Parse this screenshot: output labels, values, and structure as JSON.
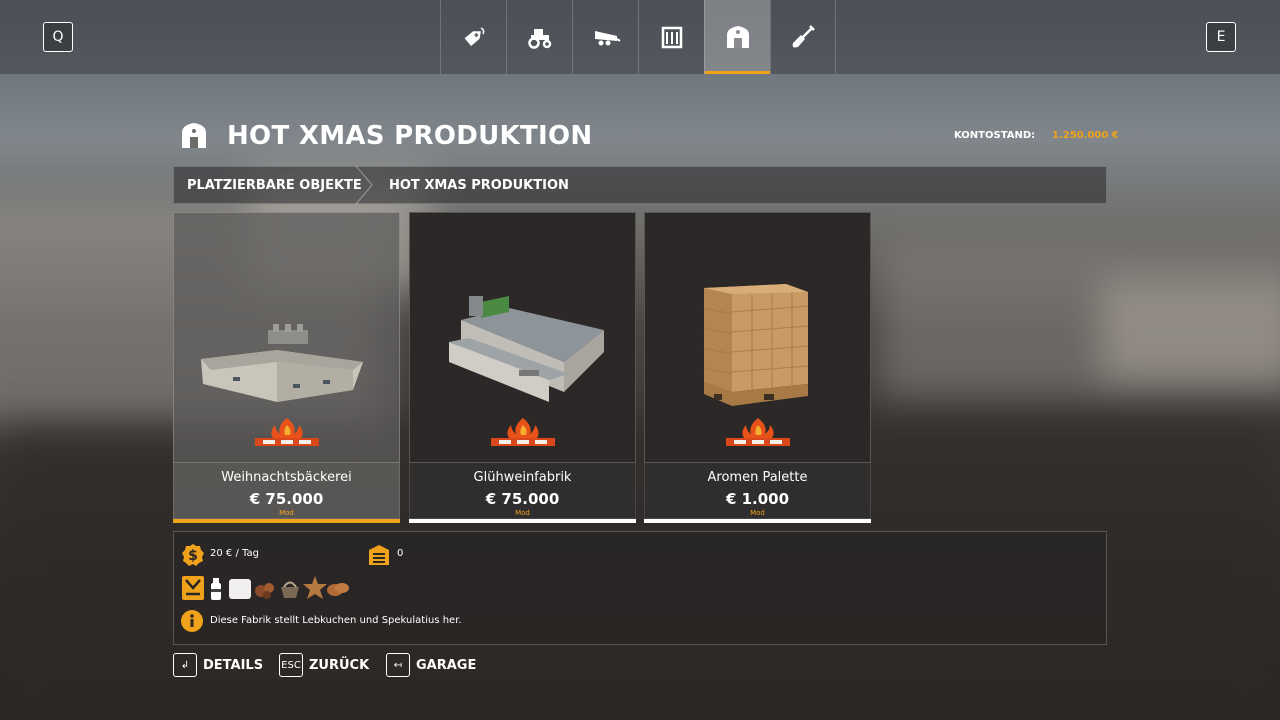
{
  "topbar": {
    "left_key": "Q",
    "right_key": "E",
    "tabs": [
      {
        "icon": "price-tag-icon",
        "active": false
      },
      {
        "icon": "tractor-icon",
        "active": false
      },
      {
        "icon": "trailer-icon",
        "active": false
      },
      {
        "icon": "silo-icon",
        "active": false
      },
      {
        "icon": "barn-icon",
        "active": true
      },
      {
        "icon": "shovel-icon",
        "active": false
      }
    ]
  },
  "header": {
    "icon": "barn-icon",
    "title": "HOT XMAS PRODUKTION",
    "balance_label": "KONTOSTAND:",
    "balance_value": "1.250.000 €"
  },
  "breadcrumb": {
    "items": [
      "PLATZIERBARE OBJEKTE",
      "HOT XMAS PRODUKTION"
    ]
  },
  "products": [
    {
      "name": "Weihnachtsbäckerei",
      "price": "€ 75.000",
      "tag": "Mod",
      "selected": true,
      "logo": "HOT"
    },
    {
      "name": "Glühweinfabrik",
      "price": "€ 75.000",
      "tag": "Mod",
      "selected": false,
      "logo": "HOT"
    },
    {
      "name": "Aromen Palette",
      "price": "€ 1.000",
      "tag": "Mod",
      "selected": false,
      "logo": "HOT"
    }
  ],
  "details": {
    "daily_cost": "20 € / Tag",
    "storage": "0",
    "inputs_icons": [
      "factory-input-icon",
      "bottle-icon",
      "flour-sack-icon",
      "spice-icon",
      "basket-icon",
      "star-cookie-icon",
      "gingerbread-icon"
    ],
    "description": "Diese Fabrik stellt Lebkuchen und Spekulatius her."
  },
  "actions": [
    {
      "key": "↲",
      "label": "DETAILS"
    },
    {
      "key": "ESC",
      "label": "ZURÜCK"
    },
    {
      "key": "↤",
      "label": "GARAGE"
    }
  ],
  "colors": {
    "accent": "#f0a21b"
  }
}
